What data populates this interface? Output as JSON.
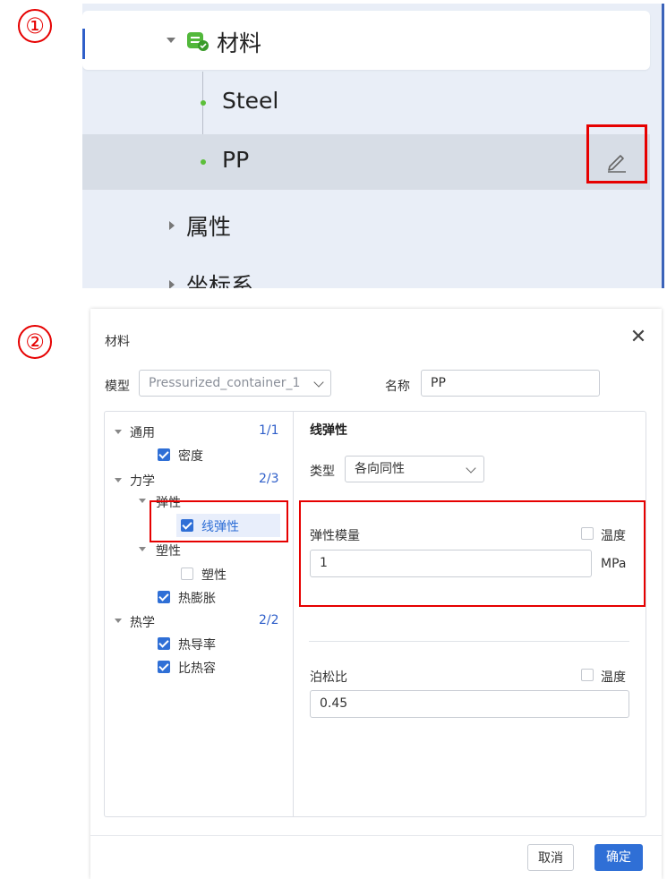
{
  "steps": {
    "one": "①",
    "two": "②"
  },
  "panel1": {
    "root_label": "材料",
    "children": [
      "Steel",
      "PP"
    ],
    "properties_label": "属性",
    "coord_label": "坐标系"
  },
  "dialog": {
    "title": "材料",
    "close": "✕",
    "model_label": "模型",
    "model_value": "Pressurized_container_1",
    "name_label": "名称",
    "name_value": "PP",
    "tree": {
      "general": {
        "label": "通用",
        "count": "1/1",
        "items": [
          "密度"
        ]
      },
      "mechanics": {
        "label": "力学",
        "count": "2/3",
        "elastic": {
          "label": "弹性",
          "item": "线弹性"
        },
        "plastic": {
          "label": "塑性",
          "item": "塑性"
        },
        "thermal_expansion": "热膨胀"
      },
      "thermal": {
        "label": "热学",
        "count": "2/2",
        "items": [
          "热导率",
          "比热容"
        ]
      }
    },
    "section_title": "线弹性",
    "type_label": "类型",
    "type_value": "各向同性",
    "modulus_label": "弹性模量",
    "modulus_temp": "温度",
    "modulus_value": "1",
    "modulus_unit": "MPa",
    "poisson_label": "泊松比",
    "poisson_temp": "温度",
    "poisson_value": "0.45",
    "cancel": "取消",
    "ok": "确定"
  },
  "colors": {
    "accent": "#2f6fd6",
    "highlight": "#e60000",
    "green": "#5cbf3a"
  }
}
